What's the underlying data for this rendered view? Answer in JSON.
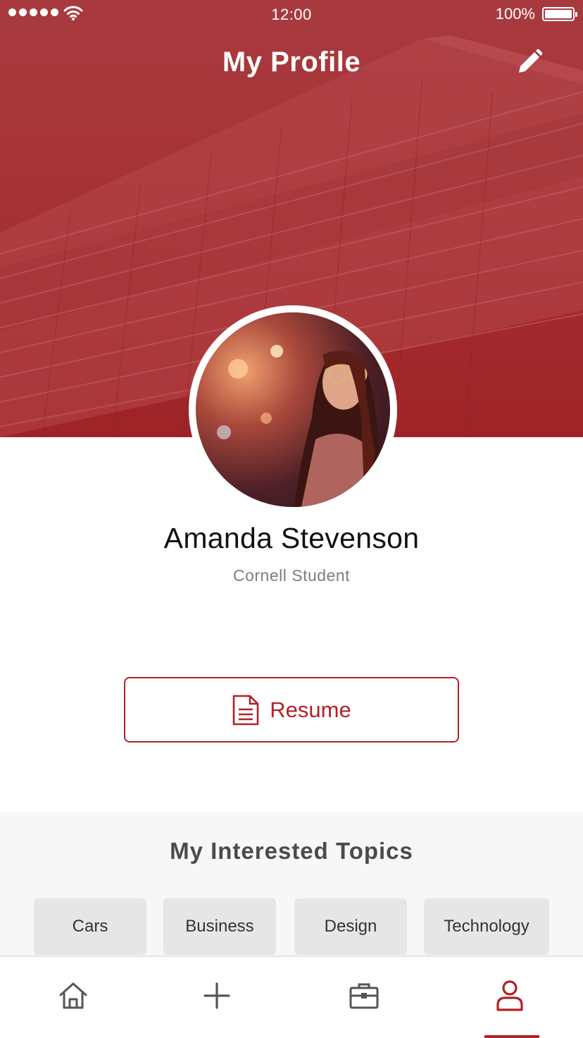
{
  "status_bar": {
    "time": "12:00",
    "battery": "100%"
  },
  "header": {
    "title": "My Profile",
    "edit_icon": "pencil-icon"
  },
  "profile": {
    "name": "Amanda Stevenson",
    "subtitle": "Cornell Student"
  },
  "resume": {
    "label": "Resume",
    "icon": "document-icon"
  },
  "topics": {
    "title": "My Interested Topics",
    "items": [
      "Cars",
      "Business",
      "Design",
      "Technology"
    ]
  },
  "tabs": [
    {
      "name": "home",
      "icon": "home-icon",
      "active": false
    },
    {
      "name": "add",
      "icon": "plus-icon",
      "active": false
    },
    {
      "name": "jobs",
      "icon": "briefcase-icon",
      "active": false
    },
    {
      "name": "profile",
      "icon": "person-icon",
      "active": true
    }
  ],
  "colors": {
    "brand": "#b02228",
    "cover": "#a73337",
    "chip_bg": "#e6e6e6",
    "section_bg": "#f7f7f7",
    "muted_text": "#7c7c86"
  }
}
